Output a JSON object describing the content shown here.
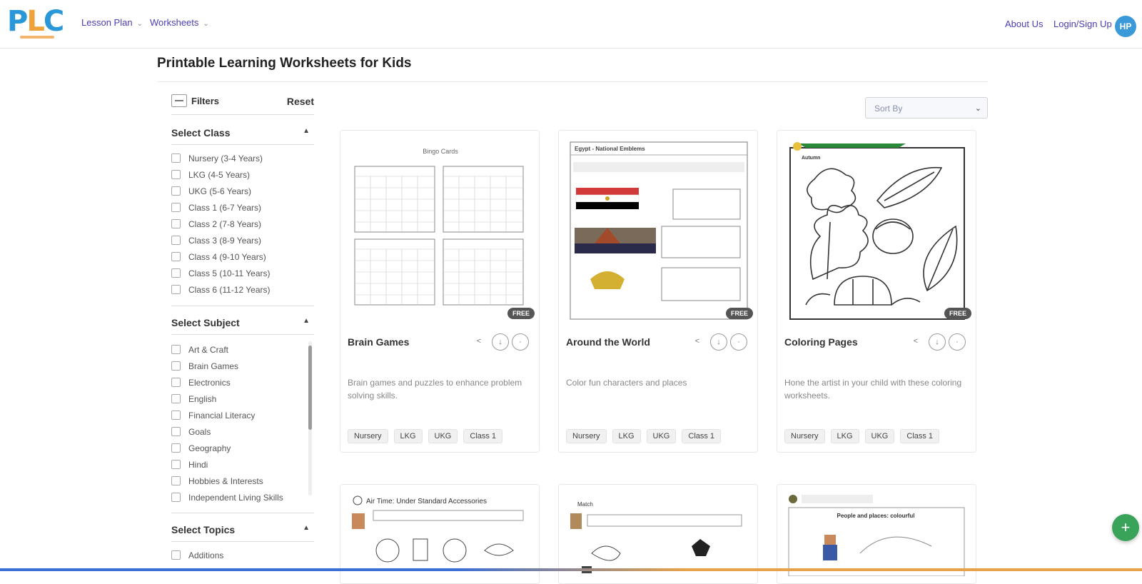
{
  "header": {
    "logo": {
      "p": "P",
      "l": "L",
      "c": "C"
    },
    "nav": [
      {
        "label": "Lesson Plan"
      },
      {
        "label": "Worksheets"
      }
    ],
    "about_label": "About Us",
    "login_label": "Login/Sign Up",
    "avatar_initials": "HP",
    "colors": {
      "nav": "#4a3db3",
      "avatar": "#3a9ad9",
      "logo_blue": "#2a98d8",
      "logo_orange": "#f0a23a"
    }
  },
  "page": {
    "title": "Printable Learning Worksheets for Kids"
  },
  "sidebar": {
    "filters_label": "Filters",
    "reset_label": "Reset",
    "sections": [
      {
        "title": "Select Class",
        "options": [
          "Nursery (3-4 Years)",
          "LKG (4-5 Years)",
          "UKG (5-6 Years)",
          "Class 1 (6-7 Years)",
          "Class 2 (7-8 Years)",
          "Class 3 (8-9 Years)",
          "Class 4 (9-10 Years)",
          "Class 5 (10-11 Years)",
          "Class 6 (11-12 Years)"
        ]
      },
      {
        "title": "Select Subject",
        "options": [
          "Art & Craft",
          "Brain Games",
          "Electronics",
          "English",
          "Financial Literacy",
          "Goals",
          "Geography",
          "Hindi",
          "Hobbies & Interests",
          "Independent Living Skills"
        ]
      },
      {
        "title": "Select Topics",
        "options": [
          "Additions"
        ]
      }
    ]
  },
  "sort": {
    "placeholder": "Sort By"
  },
  "cards": [
    {
      "title": "Brain Games",
      "description": "Brain games and puzzles to enhance problem solving skills.",
      "badge": "FREE",
      "thumb_title": "Bingo Cards",
      "tags": [
        "Nursery",
        "LKG",
        "UKG",
        "Class 1"
      ]
    },
    {
      "title": "Around the World",
      "description": "Color fun characters and places",
      "badge": "FREE",
      "thumb_title": "Egypt - National Emblems",
      "tags": [
        "Nursery",
        "LKG",
        "UKG",
        "Class 1"
      ]
    },
    {
      "title": "Coloring Pages",
      "description": "Hone the artist in your child with these coloring worksheets.",
      "badge": "FREE",
      "thumb_title": "Autumn",
      "tags": [
        "Nursery",
        "LKG",
        "UKG",
        "Class 1"
      ]
    },
    {
      "thumb_title": "Air Time: Under Standard Accessories"
    },
    {
      "thumb_title": "Match"
    },
    {
      "thumb_title": "People and places: colourful"
    }
  ],
  "fab_icon": "plus-icon"
}
